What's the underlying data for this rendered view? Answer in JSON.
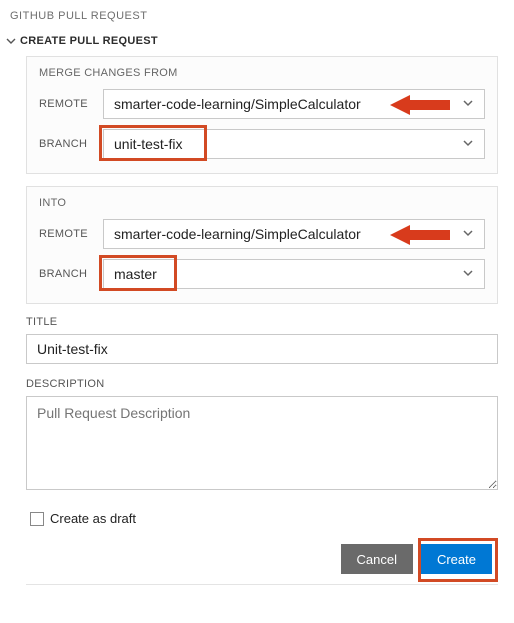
{
  "panel": {
    "title": "GITHUB PULL REQUEST"
  },
  "section": {
    "label": "CREATE PULL REQUEST"
  },
  "mergeFrom": {
    "title": "MERGE CHANGES FROM",
    "remoteLabel": "REMOTE",
    "remoteValue": "smarter-code-learning/SimpleCalculator",
    "branchLabel": "BRANCH",
    "branchValue": "unit-test-fix"
  },
  "into": {
    "title": "INTO",
    "remoteLabel": "REMOTE",
    "remoteValue": "smarter-code-learning/SimpleCalculator",
    "branchLabel": "BRANCH",
    "branchValue": "master"
  },
  "title": {
    "label": "TITLE",
    "value": "Unit-test-fix"
  },
  "description": {
    "label": "DESCRIPTION",
    "placeholder": "Pull Request Description"
  },
  "draft": {
    "label": "Create as draft"
  },
  "buttons": {
    "cancel": "Cancel",
    "create": "Create"
  },
  "annotations": {
    "highlightColor": "#d24a24"
  }
}
